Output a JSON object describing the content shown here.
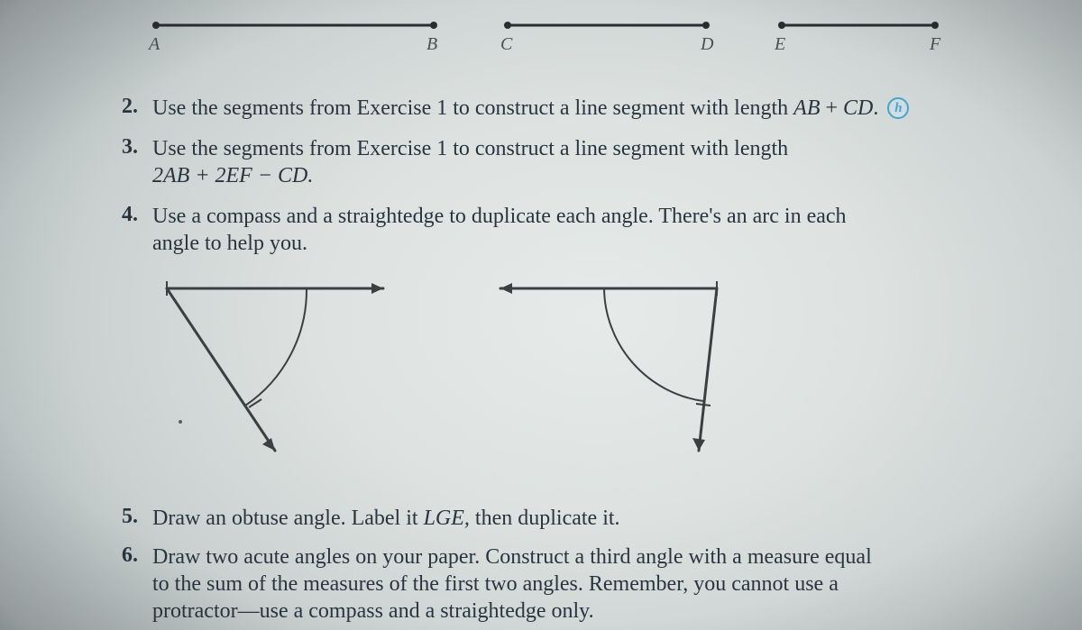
{
  "segments": {
    "labels": {
      "A": "A",
      "B": "B",
      "C": "C",
      "D": "D",
      "E": "E",
      "F": "F"
    }
  },
  "items": {
    "q2": {
      "num": "2.",
      "text_a": "Use the segments from Exercise 1 to construct a line segment with length ",
      "ab": "AB",
      "plus": " + ",
      "cd": "CD",
      "dot": "."
    },
    "q3": {
      "num": "3.",
      "text_a": "Use the segments from Exercise 1 to construct a line segment with length",
      "expr": "2AB + 2EF − CD."
    },
    "q4": {
      "num": "4.",
      "text_a": "Use a compass and a straightedge to duplicate each angle. There's an arc in each",
      "text_b": "angle to help you."
    },
    "q5": {
      "num": "5.",
      "text_a": "Draw an obtuse angle. Label it ",
      "lge": "LGE,",
      "text_b": " then duplicate it."
    },
    "q6": {
      "num": "6.",
      "text_a": "Draw two acute angles on your paper. Construct a third angle with a measure equal",
      "text_b": "to the sum of the measures of the first two angles. Remember, you cannot use a",
      "text_c": "protractor—use a compass and a straightedge only."
    }
  },
  "help_icon_glyph": "h"
}
